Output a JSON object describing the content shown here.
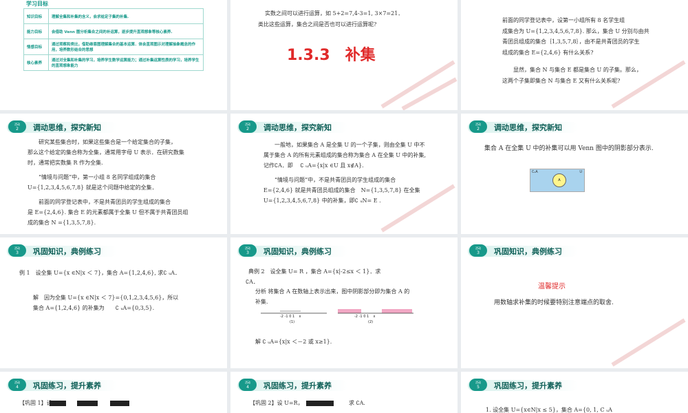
{
  "colors": {
    "accent": "#17998a",
    "red": "#e02a2a"
  },
  "s1": {
    "heading": "学习目标",
    "rows": [
      {
        "k": "知识目标",
        "v": "理解全集和补集的含义，会求给定子集的补集."
      },
      {
        "k": "能力目标",
        "v": "会借助 Venn 图分析集合之间的补运算，逐步提升直观想象等核心素养."
      },
      {
        "k": "情感目标",
        "v": "通过观察和类比，借助维恩图理解集合的基本运算．体会直观图示对理解抽象概念的作用，培养数形结合的思想"
      },
      {
        "k": "核心素养",
        "v": "通过对全集和补集的学习，培养学生数学运算能力；通过补集运算性质的学习，培养学生的直观想象能力"
      }
    ]
  },
  "s2": {
    "line1": "实数之间可以进行运算，如 5+2=7,4-3=1, 3×7=21．",
    "line2": "类比这些运算，集合之间是否也可以进行运算呢?",
    "title": "1.3.3　补集"
  },
  "s3": {
    "lines": [
      "前面的同学登记表中，设第一小组所有 8 名学生组",
      "成集合为 U={1,2,3,4,5,6,7,8}. 那么，集合 U 分别与由共",
      "青团员组成的集合｛1,3,5,7,8｝，由不是共青团员的学生",
      "组成的集合 E={2,4,6} 有什么关系?",
      "",
      "　　显然，集合 N 与集合 E 都是集合 U 的子集。那么，",
      "这两个子集即集合 N 与集合 E 又有什么关系呢?"
    ]
  },
  "s4": {
    "badge": "活动",
    "num": "2",
    "title": "调动思维，探究新知",
    "lines": [
      "　　研究某些集合时，如果这些集合是一个给定集合的子集，",
      "那么这个给定的集合称为全集，通常用字母 U 表示．在研究数集",
      "时，通常把实数集 R 作为全集.",
      "",
      "　　“情境与问题”中，第一小组 8 名同学组成的集合",
      "U={1,2,3,4,5,6,7,8} 就是这个问题中给定的全集．",
      "",
      "　　前面的同学登记表中，不是共青团员的学生组成的集合",
      "是 E={2,4,6}. 集合 E 的元素都属于全集 U 但不属于共青团员组",
      "成的集合 N ={1,3,5,7,8}."
    ]
  },
  "s5": {
    "badge": "活动",
    "num": "2",
    "title": "调动思维，探究新知",
    "lines": [
      "　　一般地，如果集合 A 是全集 U 的一个子集，则由全集 U 中不",
      "属于集合 A 的所有元素组成的集合称为集合 A 在全集 U 中的补集,",
      "记作∁A．即　 ∁ ᵤA={x|x ∈U 且 x∉A}.",
      "",
      "　　“情境与问题”中，不是共青团员的学生组成的集合",
      "E={2,4,6} 就是共青团员组成的集合　N={1,3,5,7,8} 在全集",
      "U={1,2,3,4,5,6,7,8} 中的补集，即∁ ᵤN= E ."
    ]
  },
  "s6": {
    "badge": "活动",
    "num": "2",
    "title": "调动思维，探究新知",
    "line": "集合 A 在全集 U 中的补集可以用 Venn 图中的阴影部分表示.",
    "venn_cu": "∁ᵤA",
    "venn_u": "U",
    "venn_a": "A"
  },
  "s7": {
    "badge": "活动",
    "num": "3",
    "title": "巩固知识，典例练习",
    "ex": "例 1　设全集 U={x ∈N|x ＜ 7}，集合 A={1,2,4,6}, 求∁ ᵤA．",
    "sol1": "解　因为全集 U={x ∈N|x ＜ 7}={0,1,2,3,4,5,6}，所以",
    "sol2": "集合 A={1,2,4,6} 的补集为　　∁ ᵤA={0,3,5}."
  },
  "s8": {
    "badge": "活动",
    "num": "3",
    "title": "巩固知识，典例练习",
    "ex": "典例 2　设全集 U= R ，集合 A={x|-2≤x ＜ 1}．求",
    "ex2": "∁A．",
    "an1": "分析 将集合 A 在数轴上表示出来，图中阴影部分即为集合 A 的",
    "an2": "补集.",
    "axis1": [
      "-2",
      "-1",
      "0",
      "1",
      "x"
    ],
    "axis2": [
      "-2",
      "-1",
      "0",
      "1",
      "x"
    ],
    "cap1": "(1)",
    "cap2": "(2)",
    "sol": "解 ∁ ᵤA={x|x ＜－2 或 x≥1}."
  },
  "s9": {
    "badge": "活动",
    "num": "3",
    "title": "巩固知识，典例练习",
    "tip": "温馨提示",
    "line": "用数轴求补集的时候要特别注意端点的取舍."
  },
  "s10": {
    "badge": "活动",
    "num": "4",
    "title": "巩固练习，提升素养",
    "line": "【巩固 1】设"
  },
  "s11": {
    "badge": "活动",
    "num": "4",
    "title": "巩固练习，提升素养",
    "line": "【巩固 2】设 U=R，",
    "tail": "求 ∁A."
  },
  "s12": {
    "badge": "活动",
    "num": "5",
    "title": "巩固练习，提升素养",
    "line": "1. 设全集 U={x∈N|x ≤ 5}，集合 A={0, 1, C ᵤA"
  }
}
